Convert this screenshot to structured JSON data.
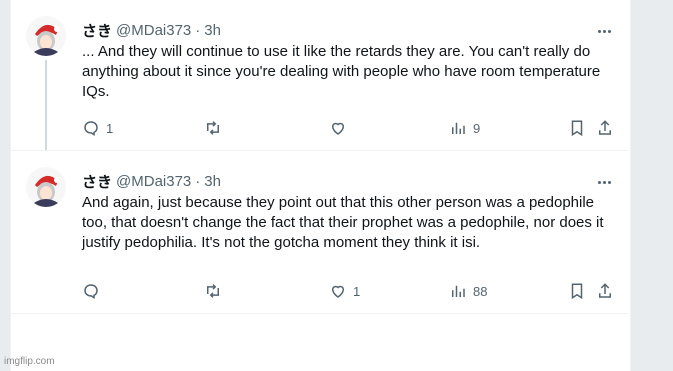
{
  "colors": {
    "text": "#0f1419",
    "secondary": "#536471",
    "border": "#eff3f4",
    "thread_line": "#cfd9de"
  },
  "tweets": [
    {
      "display_name": "さき",
      "handle": "@MDai373",
      "time": "3h",
      "text": "... And they will continue to use it like the retards they are. You can't really do anything about it since you're dealing with people who have room temperature IQs.",
      "reply_count": "1",
      "retweet_count": "",
      "like_count": "",
      "view_count": "9"
    },
    {
      "display_name": "さき",
      "handle": "@MDai373",
      "time": "3h",
      "text": "And again, just because they point out that this other person was a pedophile too, that doesn't change the fact that their prophet was a pedophile, nor does it justify pedophilia. It's not the gotcha moment they think it isi.",
      "reply_count": "",
      "retweet_count": "",
      "like_count": "1",
      "view_count": "88"
    }
  ],
  "icons": {
    "reply": "reply-icon",
    "retweet": "retweet-icon",
    "like": "heart-icon",
    "views": "views-icon",
    "bookmark": "bookmark-icon",
    "share": "share-icon",
    "more": "more-icon"
  },
  "watermark": "imgflip.com"
}
